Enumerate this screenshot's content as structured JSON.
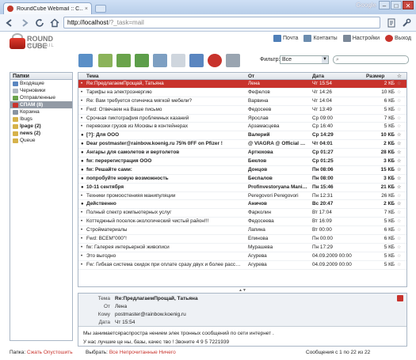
{
  "browser": {
    "tab_title": "RoundCube Webmail :: С...",
    "tab_close": "×",
    "brand": "Google",
    "url_host": "http://localhost",
    "url_path": "/?_task=mail",
    "min": "–",
    "max": "□",
    "close": "✕"
  },
  "app": {
    "logo_line1": "ROUND",
    "logo_line2": "CUBE",
    "logo_sub": "WEBMAIL",
    "nav": [
      {
        "label": "Почта",
        "color": "#4f7fb8"
      },
      {
        "label": "Контакты",
        "color": "#6b8cae"
      },
      {
        "label": "Настройки",
        "color": "#7b8898"
      },
      {
        "label": "Выход",
        "color": "#c8332c"
      }
    ]
  },
  "toolbar": {
    "filter_label": "Фильтр:",
    "filter_value": "Все",
    "filter_arrow": "▼",
    "buttons": [
      {
        "name": "check-mail-button",
        "color": "#5a8fc7"
      },
      {
        "name": "compose-button",
        "color": "#8bb35a"
      },
      {
        "name": "reply-button",
        "color": "#6aa34b"
      },
      {
        "name": "reply-all-button",
        "color": "#5d9e4a"
      },
      {
        "name": "forward-button",
        "color": "#7d9fc2"
      },
      {
        "name": "delete-button",
        "color": "#cfd6de"
      },
      {
        "name": "mark-button",
        "color": "#5a86c0"
      },
      {
        "name": "more-button",
        "color": "#c8332c"
      },
      {
        "name": "print-button",
        "color": "#9aa5b1"
      }
    ]
  },
  "folders": {
    "title": "Папки",
    "items": [
      {
        "label": "Входящие",
        "color": "#5a86c0",
        "state": ""
      },
      {
        "label": "Черновики",
        "color": "#b0b8c2",
        "state": ""
      },
      {
        "label": "Отправленные",
        "color": "#6aa34b",
        "state": ""
      },
      {
        "label": "СПАМ (8)",
        "color": "#c8332c",
        "state": "sel"
      },
      {
        "label": "Корзина",
        "color": "#8894a2",
        "state": ""
      },
      {
        "label": "Ibugs",
        "color": "#d6b24a",
        "state": ""
      },
      {
        "label": "Ipage (2)",
        "color": "#d6b24a",
        "state": "bold"
      },
      {
        "label": "news (2)",
        "color": "#d6b24a",
        "state": "bold"
      },
      {
        "label": "Queue",
        "color": "#d6b24a",
        "state": ""
      }
    ]
  },
  "list": {
    "headers": {
      "subject": "Тема",
      "from": "От",
      "date": "Дата",
      "size": "Размер",
      "flag": "☆"
    },
    "rows": [
      {
        "subject": "Re:ПредлагаемПрощай, Татьяна",
        "from": "Лена",
        "date": "Чт 15:54",
        "size": "2 КБ",
        "state": "sel",
        "icon": "•"
      },
      {
        "subject": "Тарифы на электроэнергию",
        "from": "Фефелов",
        "date": "Чт 14:26",
        "size": "10 КБ",
        "state": "",
        "icon": "•"
      },
      {
        "subject": "Re: Вам требуется спичечка мягкой мебели?",
        "from": "Варвина",
        "date": "Чт 14:04",
        "size": "6 КБ",
        "state": "",
        "icon": "•"
      },
      {
        "subject": "Fwd: Отвечаем на Ваше письмо",
        "from": "Федосеев",
        "date": "Чт 13:49",
        "size": "5 КБ",
        "state": "",
        "icon": "•"
      },
      {
        "subject": "Срочная пиктография проблемных казаний",
        "from": "Ярослав",
        "date": "Ср 09:00",
        "size": "7 КБ",
        "state": "",
        "icon": "•"
      },
      {
        "subject": "перевозки грузов из Москвы в контейнерах",
        "from": "Арзамасцева",
        "date": "Ср 16:40",
        "size": "5 КБ",
        "state": "",
        "icon": "•"
      },
      {
        "subject": "[?]: Для ООО",
        "from": "Валерий",
        "date": "Ср 14:29",
        "size": "10 КБ",
        "state": "unread",
        "icon": "●"
      },
      {
        "subject": "Dear postmaster@rainbow.koenig.ru 75% 0FF on Pfizer !",
        "from": "@ VIAGRA @ Official Site",
        "date": "Чт 04:01",
        "size": "2 КБ",
        "state": "unread",
        "icon": "●"
      },
      {
        "subject": "Ангары для самолетов и вертолетов",
        "from": "Артюхова",
        "date": "Ср 01:27",
        "size": "28 КБ",
        "state": "unread",
        "icon": "●"
      },
      {
        "subject": "fw: перерегистрация ООО",
        "from": "Беклов",
        "date": "Ср 01:25",
        "size": "3 КБ",
        "state": "unread",
        "icon": "●"
      },
      {
        "subject": "fw: Решайте сами:",
        "from": "Донцов",
        "date": "Пн 08:06",
        "size": "15 КБ",
        "state": "unread",
        "icon": "●"
      },
      {
        "subject": "попробуйте новую возможность",
        "from": "Беспалов",
        "date": "Пн 08:00",
        "size": "3 КБ",
        "state": "unread",
        "icon": "●"
      },
      {
        "subject": "10-11 сентября",
        "from": "Profinvestoryana Manipul...",
        "date": "Пн 15:46",
        "size": "21 КБ",
        "state": "unread",
        "icon": "●"
      },
      {
        "subject": "Техники промоостенияя манипуляции",
        "from": "Peregovori Peregovori",
        "date": "Пн 12:31",
        "size": "26 КБ",
        "state": "",
        "icon": "•"
      },
      {
        "subject": "Действенно",
        "from": "Аничов",
        "date": "Вс 20:47",
        "size": "2 КБ",
        "state": "unread",
        "icon": "●"
      },
      {
        "subject": "Полный спектр компьютерных услуг",
        "from": "Фарколин",
        "date": "Вт 17:04",
        "size": "7 КБ",
        "state": "",
        "icon": "•"
      },
      {
        "subject": "Коттеджный поселок-экологический чистый район!!!",
        "from": "Федосеева",
        "date": "Вт 16:09",
        "size": "5 КБ",
        "state": "",
        "icon": "•"
      },
      {
        "subject": "Стройматериалы",
        "from": "Лапина",
        "date": "Вт 00:00",
        "size": "6 КБ",
        "state": "",
        "icon": "•"
      },
      {
        "subject": "Fwd: ВСЕМ\"000\"!",
        "from": "Епинова",
        "date": "Пн 00:00",
        "size": "6 КБ",
        "state": "",
        "icon": "•"
      },
      {
        "subject": "fw: Галерея интерьерной живописи",
        "from": "Мурашева",
        "date": "Пн 17:29",
        "size": "5 КБ",
        "state": "",
        "icon": "•"
      },
      {
        "subject": "Это выгодно",
        "from": "Агурева",
        "date": "04.09.2009 00:00",
        "size": "5 КБ",
        "state": "",
        "icon": "•"
      },
      {
        "subject": "Fw: Гибкая система скидок при оплате сразу двух и более рассыл...",
        "from": "Агурева",
        "date": "04.09.2009 00:00",
        "size": "5 КБ",
        "state": "",
        "icon": "•"
      }
    ]
  },
  "preview": {
    "subject_label": "Тема",
    "subject": "Re:ПредлагаемПрощай, Татьяна",
    "from_label": "От",
    "from": "Лена",
    "to_label": "Кому",
    "to": "postmaster@rainbow.koenig.ru",
    "date_label": "Дата",
    "date": "Чт 15:54",
    "body_line1": "Мы занимаетсярaспростра  нением элек  тронных сообщений по сети интернет .",
    "body_line2": "У нас   лучшие це ны,   базы, качес тво  ! Звоните  4 9 5 7221939"
  },
  "footer": {
    "folders_label": "Папка:",
    "compact": "Сжать",
    "empty": "Опустошить",
    "select_label": "Выбрать:",
    "all": "Все",
    "unread": "Непрочитанные",
    "none": "Ничего",
    "count": "Сообщения с 1 по 22 из 22"
  }
}
